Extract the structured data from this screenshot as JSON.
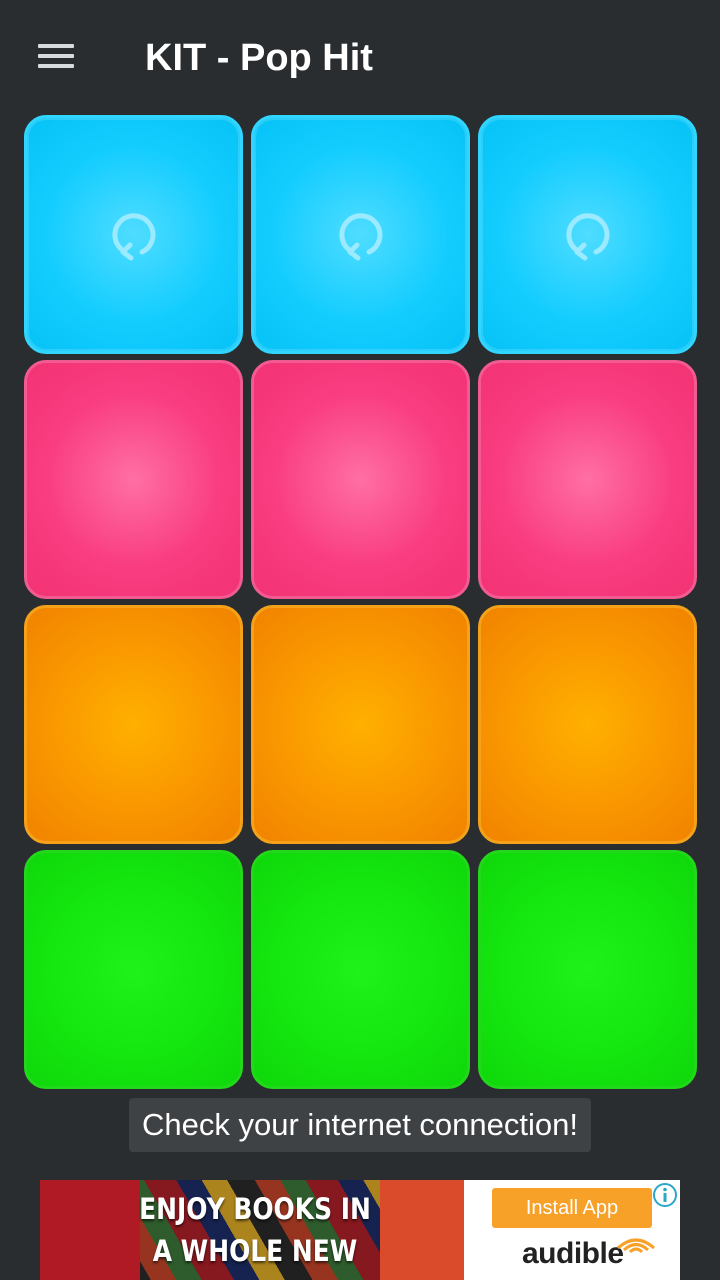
{
  "toolbar": {
    "menu_icon": "hamburger-menu-icon",
    "title": "KIT - Pop Hit"
  },
  "pads": {
    "rows": [
      {
        "color": "cyan",
        "hex": "#14cdff",
        "pads": [
          {
            "icon": "loop-icon"
          },
          {
            "icon": "loop-icon"
          },
          {
            "icon": "loop-icon"
          }
        ]
      },
      {
        "color": "pink",
        "hex": "#f93d80",
        "pads": [
          {},
          {},
          {}
        ]
      },
      {
        "color": "orange",
        "hex": "#f99600",
        "pads": [
          {},
          {},
          {}
        ]
      },
      {
        "color": "green",
        "hex": "#14e60f",
        "pads": [
          {},
          {},
          {}
        ]
      }
    ]
  },
  "toast": {
    "message": "Check your internet connection!"
  },
  "ad": {
    "headline_line1": "ENJOY BOOKS IN",
    "headline_line2": "A WHOLE NEW WAY.",
    "cta_label": "Install App",
    "brand": "audible",
    "info_icon": "info-icon",
    "cta_color": "#f7a128"
  }
}
